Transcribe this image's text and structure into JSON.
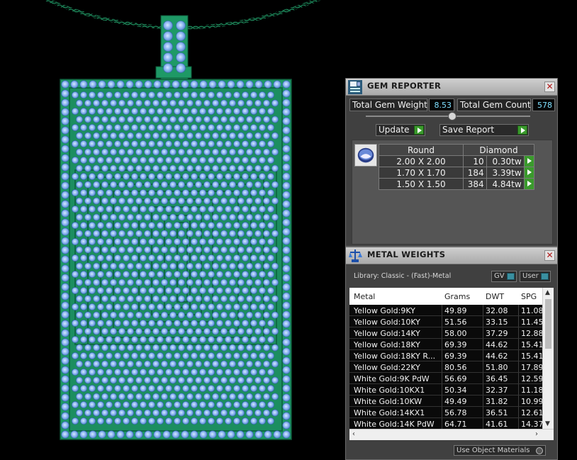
{
  "gem_reporter": {
    "title": "GEM REPORTER",
    "total_weight_label": "Total Gem Weight",
    "total_weight_value": "8.53",
    "total_count_label": "Total Gem Count",
    "total_count_value": "578",
    "update_label": "Update",
    "save_report_label": "Save Report",
    "header_shape": "Round",
    "header_type": "Diamond",
    "rows": [
      {
        "size": "2.00 X 2.00",
        "count": "10",
        "weight": "0.30tw"
      },
      {
        "size": "1.70 X 1.70",
        "count": "184",
        "weight": "3.39tw"
      },
      {
        "size": "1.50 X 1.50",
        "count": "384",
        "weight": "4.84tw"
      }
    ]
  },
  "metal_weights": {
    "title": "METAL WEIGHTS",
    "library": "Library: Classic - (Fast)-Metal",
    "gv_label": "GV",
    "user_label": "User",
    "columns": [
      "Metal",
      "Grams",
      "DWT",
      "SPG"
    ],
    "rows": [
      {
        "metal": "Yellow Gold:9KY",
        "grams": "49.89",
        "dwt": "32.08",
        "spg": "11.08"
      },
      {
        "metal": "Yellow Gold:10KY",
        "grams": "51.56",
        "dwt": "33.15",
        "spg": "11.45"
      },
      {
        "metal": "Yellow Gold:14KY",
        "grams": "58.00",
        "dwt": "37.29",
        "spg": "12.88"
      },
      {
        "metal": "Yellow Gold:18KY",
        "grams": "69.39",
        "dwt": "44.62",
        "spg": "15.41"
      },
      {
        "metal": "Yellow Gold:18KY R...",
        "grams": "69.39",
        "dwt": "44.62",
        "spg": "15.41"
      },
      {
        "metal": "Yellow Gold:22KY",
        "grams": "80.56",
        "dwt": "51.80",
        "spg": "17.89"
      },
      {
        "metal": "White Gold:9K PdW",
        "grams": "56.69",
        "dwt": "36.45",
        "spg": "12.59"
      },
      {
        "metal": "White Gold:10KX1",
        "grams": "50.34",
        "dwt": "32.37",
        "spg": "11.18"
      },
      {
        "metal": "White Gold:10KW",
        "grams": "49.49",
        "dwt": "31.82",
        "spg": "10.99"
      },
      {
        "metal": "White Gold:14KX1",
        "grams": "56.78",
        "dwt": "36.51",
        "spg": "12.61"
      },
      {
        "metal": "White Gold:14K PdW",
        "grams": "64.71",
        "dwt": "41.61",
        "spg": "14.37"
      }
    ],
    "use_object_materials": "Use Object Materials"
  },
  "colors": {
    "metal_green": "#1e9966",
    "gem_blue": "#8fbcf5",
    "accent_value": "#7fe0ff"
  }
}
